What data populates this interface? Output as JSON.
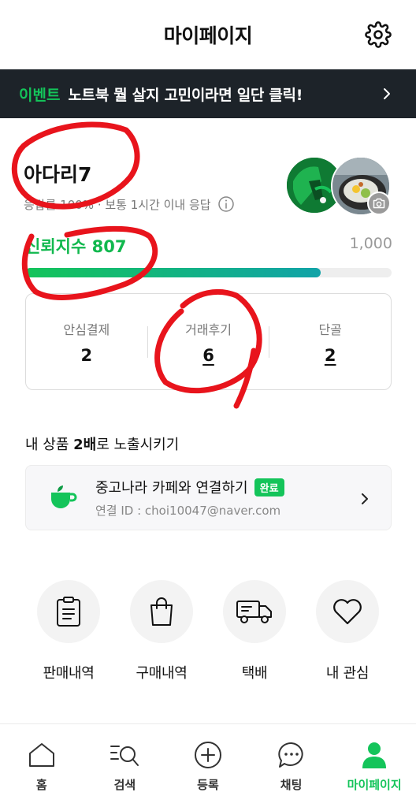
{
  "header": {
    "title": "마이페이지",
    "settings_icon": "gear-icon"
  },
  "event_banner": {
    "tag": "이벤트",
    "text": "노트북 뭘 살지 고민이라면 일단 클릭!",
    "chevron_icon": "chevron-right-icon"
  },
  "profile": {
    "nickname": "아다리7",
    "reply_info": "응답률 100% · 보통 1시간 이내 응답",
    "info_icon": "info-icon",
    "camera_icon": "camera-icon"
  },
  "trust": {
    "label": "신뢰지수",
    "score": "807",
    "max": "1,000",
    "progress_fraction": 0.807
  },
  "stats": [
    {
      "label": "안심결제",
      "value": "2"
    },
    {
      "label": "거래후기",
      "value": "6"
    },
    {
      "label": "단골",
      "value": "2"
    }
  ],
  "expose": {
    "prefix": "내 상품 ",
    "bold": "2배",
    "suffix": "로 노출시키기"
  },
  "cafe": {
    "title": "중고나라 카페와 연결하기",
    "badge": "완료",
    "sub": "연결 ID : choi10047@naver.com",
    "icon": "cup-icon"
  },
  "quick_menu": [
    {
      "label": "판매내역",
      "icon": "clipboard-icon"
    },
    {
      "label": "구매내역",
      "icon": "shopping-bag-icon"
    },
    {
      "label": "택배",
      "icon": "truck-icon"
    },
    {
      "label": "내 관심",
      "icon": "heart-icon"
    }
  ],
  "bottom_nav": [
    {
      "label": "홈",
      "icon": "home-icon"
    },
    {
      "label": "검색",
      "icon": "search-icon"
    },
    {
      "label": "등록",
      "icon": "plus-circle-icon"
    },
    {
      "label": "채팅",
      "icon": "chat-icon"
    },
    {
      "label": "마이페이지",
      "icon": "person-icon",
      "active": true
    }
  ],
  "colors": {
    "brand_green": "#14c45a",
    "banner_bg": "#1d2329",
    "annotation_red": "#e8141c"
  }
}
